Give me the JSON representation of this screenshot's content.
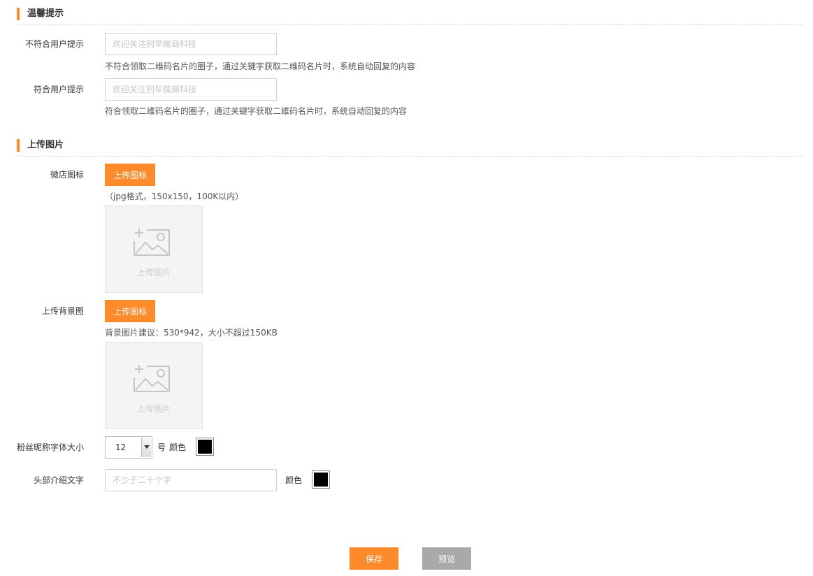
{
  "sections": {
    "tips": {
      "title": "温馨提示"
    },
    "upload": {
      "title": "上传图片"
    }
  },
  "tips": {
    "nonmatch": {
      "label": "不符合用户提示",
      "placeholder": "欢迎关注别早微商科技",
      "hint": "不符合领取二维码名片的圈子，通过关键字获取二维码名片时，系统自动回复的内容"
    },
    "match": {
      "label": "符合用户提示",
      "placeholder": "欢迎关注别早微商科技",
      "hint": "符合领取二维码名片的圈子，通过关键字获取二维码名片时，系统自动回复的内容"
    }
  },
  "upload": {
    "icon": {
      "label": "微店图标",
      "button": "上传图标",
      "hint": "（jpg格式，150x150，100K以内）",
      "placeholder_text": "上传图片"
    },
    "background": {
      "label": "上传背景图",
      "button": "上传图标",
      "hint": "背景图片建议：530*942，大小不超过150KB",
      "placeholder_text": "上传图片"
    }
  },
  "font": {
    "label": "粉丝昵称字体大小",
    "size_value": "12",
    "unit": "号",
    "color_label": "颜色",
    "color": "#000000"
  },
  "header_text": {
    "label": "头部介绍文字",
    "placeholder": "不少于二十个字",
    "color_label": "颜色",
    "color": "#000000"
  },
  "actions": {
    "save": "保存",
    "preview": "预览"
  },
  "colors": {
    "accent": "#ff8a2a",
    "preview_button": "#a9a9a9"
  }
}
